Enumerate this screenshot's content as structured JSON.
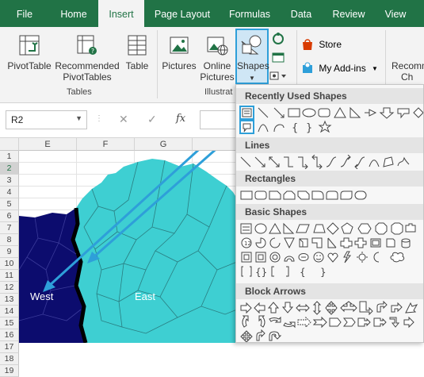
{
  "tabs": [
    "File",
    "Home",
    "Insert",
    "Page Layout",
    "Formulas",
    "Data",
    "Review",
    "View"
  ],
  "active_tab": "Insert",
  "ribbon": {
    "pivottable": "PivotTable",
    "recommended_1": "Recommended",
    "recommended_2": "PivotTables",
    "table": "Table",
    "tables_group": "Tables",
    "pictures": "Pictures",
    "online_1": "Online",
    "online_2": "Pictures",
    "shapes": "Shapes",
    "illustrations_group": "Illustrat",
    "store": "Store",
    "addins": "My Add-ins",
    "recommended_charts_1": "Recomm",
    "recommended_charts_2": "Ch"
  },
  "formula_bar": {
    "name_box": "R2",
    "fx": "fx"
  },
  "columns": [
    "E",
    "F",
    "G"
  ],
  "rows": [
    "1",
    "2",
    "3",
    "4",
    "5",
    "6",
    "7",
    "8",
    "9",
    "10",
    "11",
    "12",
    "13",
    "14",
    "15",
    "16",
    "17",
    "18",
    "19"
  ],
  "selected_row": "2",
  "map": {
    "west_label": "West",
    "east_label": "East",
    "west_color": "#0c0c6e",
    "east_color": "#3ecfd2",
    "border_color": "#000000"
  },
  "arrow_color": "#2e9fd9",
  "shapes_panel": {
    "sections": [
      "Recently Used Shapes",
      "Lines",
      "Rectangles",
      "Basic Shapes",
      "Block Arrows"
    ],
    "highlight_color": "#2e9fd9"
  },
  "colors": {
    "excel_green": "#217346",
    "ribbon_bg": "#f3f3f3"
  }
}
